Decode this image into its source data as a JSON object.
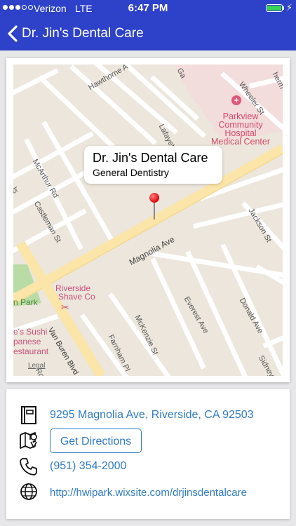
{
  "status_bar": {
    "carrier": "Verizon",
    "network": "LTE",
    "time": "6:47 PM",
    "signal_bars_filled": 3,
    "signal_bars_total": 5,
    "battery_level": 1.0,
    "battery_color": "#39d353"
  },
  "nav": {
    "back_icon": "chevron-left-icon",
    "title": "Dr. Jin's Dental Care",
    "background": "#2e42c9"
  },
  "map": {
    "callout_title": "Dr. Jin's Dental Care",
    "callout_subtitle": "General Dentistry",
    "legal": "Legal",
    "hospital_lines": [
      "Parkview",
      "Community",
      "Hospital",
      "Medical Center"
    ],
    "poi_barber": [
      "Riverside",
      "Shave Co"
    ],
    "poi_sushi": [
      "e's Sushi",
      "panese",
      "estaurant"
    ],
    "park_label": "n Park",
    "streets": {
      "hawthorne": "Hawthorne A",
      "wheeler": "Wheeler St",
      "lafayette": "Lafayette St",
      "mcarthur": "McArthur Rd",
      "castleman": "Castleman St",
      "jackson": "Jackson St",
      "magnolia": "Magnolia Ave",
      "everest": "Everest Ave",
      "donald": "Donald Ave",
      "mckenzie": "McKenzie St",
      "farnham": "Farnham Pl",
      "vanburen": "Van Buren Blvd",
      "sidney": "Sidney",
      "roos": "Roos",
      "ga": "Ga",
      "herm": "herm",
      "ls": "ls"
    }
  },
  "info": {
    "address": "9295 Magnolia Ave, Riverside, CA 92503",
    "directions_label": "Get Directions",
    "phone": "(951) 354-2000",
    "website": "http://hwipark.wixsite.com/drjinsdentalcare",
    "link_color": "#2f7bc7"
  }
}
